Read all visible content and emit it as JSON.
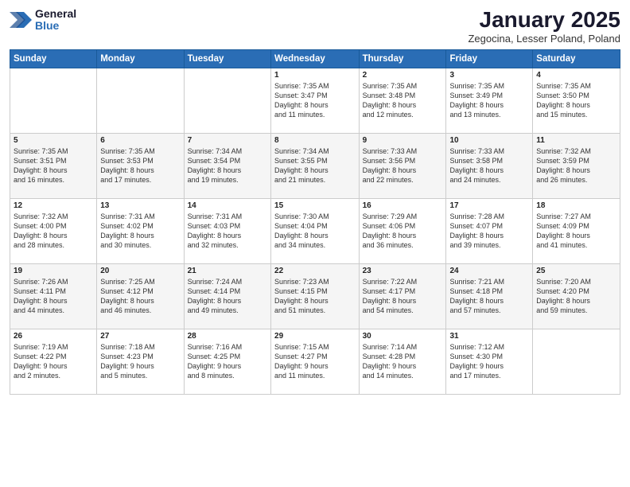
{
  "header": {
    "logo_general": "General",
    "logo_blue": "Blue",
    "month_title": "January 2025",
    "location": "Zegocina, Lesser Poland, Poland"
  },
  "days_of_week": [
    "Sunday",
    "Monday",
    "Tuesday",
    "Wednesday",
    "Thursday",
    "Friday",
    "Saturday"
  ],
  "weeks": [
    [
      {
        "num": "",
        "info": ""
      },
      {
        "num": "",
        "info": ""
      },
      {
        "num": "",
        "info": ""
      },
      {
        "num": "1",
        "info": "Sunrise: 7:35 AM\nSunset: 3:47 PM\nDaylight: 8 hours\nand 11 minutes."
      },
      {
        "num": "2",
        "info": "Sunrise: 7:35 AM\nSunset: 3:48 PM\nDaylight: 8 hours\nand 12 minutes."
      },
      {
        "num": "3",
        "info": "Sunrise: 7:35 AM\nSunset: 3:49 PM\nDaylight: 8 hours\nand 13 minutes."
      },
      {
        "num": "4",
        "info": "Sunrise: 7:35 AM\nSunset: 3:50 PM\nDaylight: 8 hours\nand 15 minutes."
      }
    ],
    [
      {
        "num": "5",
        "info": "Sunrise: 7:35 AM\nSunset: 3:51 PM\nDaylight: 8 hours\nand 16 minutes."
      },
      {
        "num": "6",
        "info": "Sunrise: 7:35 AM\nSunset: 3:53 PM\nDaylight: 8 hours\nand 17 minutes."
      },
      {
        "num": "7",
        "info": "Sunrise: 7:34 AM\nSunset: 3:54 PM\nDaylight: 8 hours\nand 19 minutes."
      },
      {
        "num": "8",
        "info": "Sunrise: 7:34 AM\nSunset: 3:55 PM\nDaylight: 8 hours\nand 21 minutes."
      },
      {
        "num": "9",
        "info": "Sunrise: 7:33 AM\nSunset: 3:56 PM\nDaylight: 8 hours\nand 22 minutes."
      },
      {
        "num": "10",
        "info": "Sunrise: 7:33 AM\nSunset: 3:58 PM\nDaylight: 8 hours\nand 24 minutes."
      },
      {
        "num": "11",
        "info": "Sunrise: 7:32 AM\nSunset: 3:59 PM\nDaylight: 8 hours\nand 26 minutes."
      }
    ],
    [
      {
        "num": "12",
        "info": "Sunrise: 7:32 AM\nSunset: 4:00 PM\nDaylight: 8 hours\nand 28 minutes."
      },
      {
        "num": "13",
        "info": "Sunrise: 7:31 AM\nSunset: 4:02 PM\nDaylight: 8 hours\nand 30 minutes."
      },
      {
        "num": "14",
        "info": "Sunrise: 7:31 AM\nSunset: 4:03 PM\nDaylight: 8 hours\nand 32 minutes."
      },
      {
        "num": "15",
        "info": "Sunrise: 7:30 AM\nSunset: 4:04 PM\nDaylight: 8 hours\nand 34 minutes."
      },
      {
        "num": "16",
        "info": "Sunrise: 7:29 AM\nSunset: 4:06 PM\nDaylight: 8 hours\nand 36 minutes."
      },
      {
        "num": "17",
        "info": "Sunrise: 7:28 AM\nSunset: 4:07 PM\nDaylight: 8 hours\nand 39 minutes."
      },
      {
        "num": "18",
        "info": "Sunrise: 7:27 AM\nSunset: 4:09 PM\nDaylight: 8 hours\nand 41 minutes."
      }
    ],
    [
      {
        "num": "19",
        "info": "Sunrise: 7:26 AM\nSunset: 4:11 PM\nDaylight: 8 hours\nand 44 minutes."
      },
      {
        "num": "20",
        "info": "Sunrise: 7:25 AM\nSunset: 4:12 PM\nDaylight: 8 hours\nand 46 minutes."
      },
      {
        "num": "21",
        "info": "Sunrise: 7:24 AM\nSunset: 4:14 PM\nDaylight: 8 hours\nand 49 minutes."
      },
      {
        "num": "22",
        "info": "Sunrise: 7:23 AM\nSunset: 4:15 PM\nDaylight: 8 hours\nand 51 minutes."
      },
      {
        "num": "23",
        "info": "Sunrise: 7:22 AM\nSunset: 4:17 PM\nDaylight: 8 hours\nand 54 minutes."
      },
      {
        "num": "24",
        "info": "Sunrise: 7:21 AM\nSunset: 4:18 PM\nDaylight: 8 hours\nand 57 minutes."
      },
      {
        "num": "25",
        "info": "Sunrise: 7:20 AM\nSunset: 4:20 PM\nDaylight: 8 hours\nand 59 minutes."
      }
    ],
    [
      {
        "num": "26",
        "info": "Sunrise: 7:19 AM\nSunset: 4:22 PM\nDaylight: 9 hours\nand 2 minutes."
      },
      {
        "num": "27",
        "info": "Sunrise: 7:18 AM\nSunset: 4:23 PM\nDaylight: 9 hours\nand 5 minutes."
      },
      {
        "num": "28",
        "info": "Sunrise: 7:16 AM\nSunset: 4:25 PM\nDaylight: 9 hours\nand 8 minutes."
      },
      {
        "num": "29",
        "info": "Sunrise: 7:15 AM\nSunset: 4:27 PM\nDaylight: 9 hours\nand 11 minutes."
      },
      {
        "num": "30",
        "info": "Sunrise: 7:14 AM\nSunset: 4:28 PM\nDaylight: 9 hours\nand 14 minutes."
      },
      {
        "num": "31",
        "info": "Sunrise: 7:12 AM\nSunset: 4:30 PM\nDaylight: 9 hours\nand 17 minutes."
      },
      {
        "num": "",
        "info": ""
      }
    ]
  ]
}
